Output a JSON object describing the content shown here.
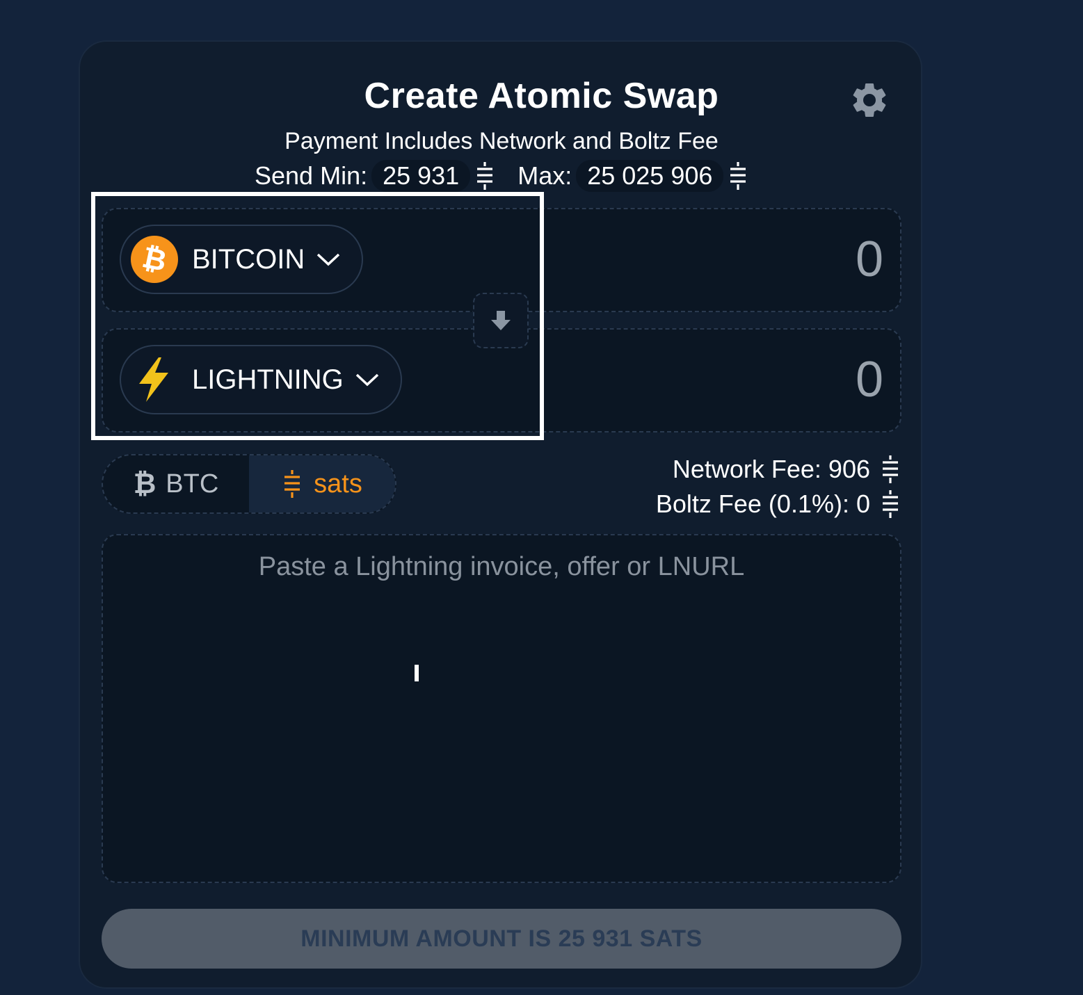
{
  "header": {
    "title": "Create Atomic Swap",
    "subtitle": "Payment Includes Network and Boltz Fee",
    "settings_icon": "gear-icon"
  },
  "limits": {
    "min_label": "Send Min:",
    "min_value": "25 931",
    "max_label": "Max:",
    "max_value": "25 025 906",
    "unit_icon": "sats-icon"
  },
  "send": {
    "asset": "BITCOIN",
    "asset_icon": "bitcoin-icon",
    "amount": "0"
  },
  "receive": {
    "asset": "LIGHTNING",
    "asset_icon": "lightning-icon",
    "amount": "0"
  },
  "switch_icon": "arrow-down-icon",
  "denomination": {
    "btc_label": "BTC",
    "sats_label": "sats",
    "selected": "sats"
  },
  "fees": {
    "network_label": "Network Fee: 906",
    "boltz_label": "Boltz Fee (0.1%): 0"
  },
  "invoice": {
    "placeholder": "Paste a Lightning invoice, offer or LNURL",
    "value": ""
  },
  "submit": {
    "label": "MINIMUM AMOUNT IS 25 931 SATS"
  },
  "colors": {
    "background": "#13233b",
    "card": "#101d2e",
    "accent": "#f7931a",
    "lightning": "#f2c21b",
    "button_disabled": "#525c69"
  }
}
